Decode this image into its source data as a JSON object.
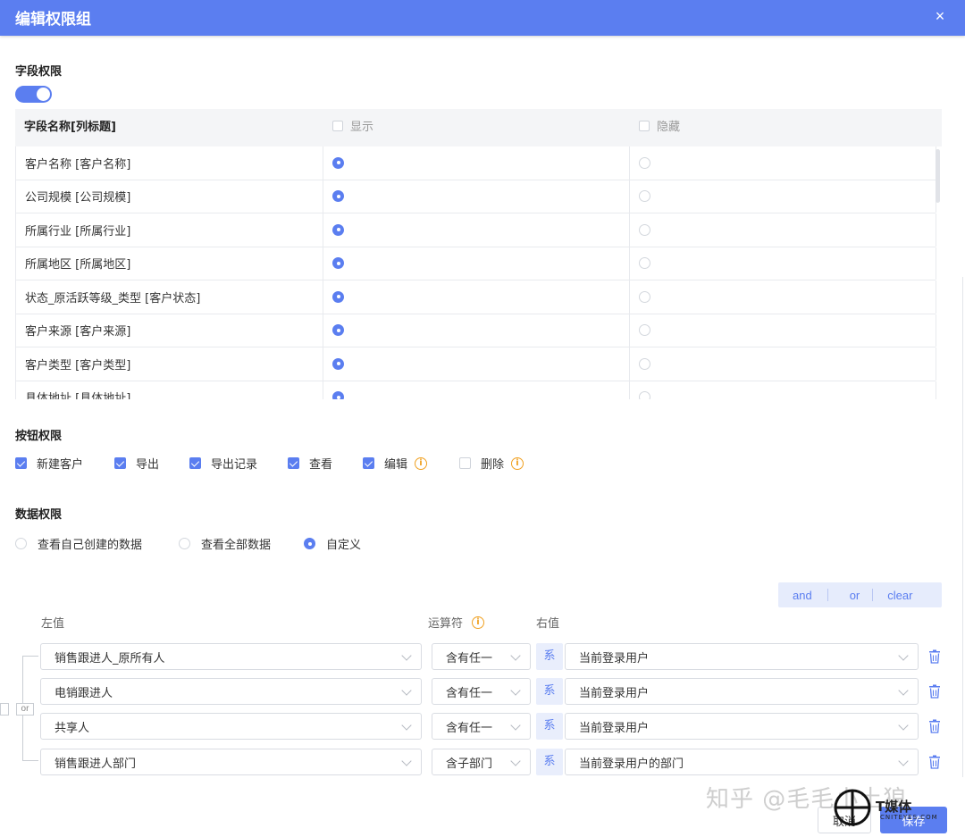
{
  "header": {
    "title": "编辑权限组",
    "close_icon": "×"
  },
  "field_permissions": {
    "title": "字段权限",
    "enabled": true,
    "columns": [
      "字段名称[列标题]",
      "显示",
      "隐藏"
    ],
    "rows": [
      {
        "name": "客户名称 [客户名称]",
        "value": "显示"
      },
      {
        "name": "公司规模 [公司规模]",
        "value": "显示"
      },
      {
        "name": "所属行业 [所属行业]",
        "value": "显示"
      },
      {
        "name": "所属地区 [所属地区]",
        "value": "显示"
      },
      {
        "name": "状态_原活跃等级_类型 [客户状态]",
        "value": "显示"
      },
      {
        "name": "客户来源 [客户来源]",
        "value": "显示"
      },
      {
        "name": "客户类型 [客户类型]",
        "value": "显示"
      },
      {
        "name": "具体地址 [具体地址]",
        "value": "显示"
      }
    ]
  },
  "button_permissions": {
    "title": "按钮权限",
    "items": [
      {
        "label": "新建客户",
        "checked": true,
        "info": false
      },
      {
        "label": "导出",
        "checked": true,
        "info": false
      },
      {
        "label": "导出记录",
        "checked": true,
        "info": false
      },
      {
        "label": "查看",
        "checked": true,
        "info": false
      },
      {
        "label": "编辑",
        "checked": true,
        "info": true
      },
      {
        "label": "删除",
        "checked": false,
        "info": true
      }
    ]
  },
  "data_permissions": {
    "title": "数据权限",
    "options": [
      "查看自己创建的数据",
      "查看全部数据",
      "自定义"
    ],
    "selected": "自定义"
  },
  "logic_buttons": {
    "and": "and",
    "or": "or",
    "clear": "clear"
  },
  "conditions_header": {
    "left": "左值",
    "operator": "运算符",
    "right": "右值"
  },
  "or_badge": "or",
  "conditions": [
    {
      "left": "销售跟进人_原所有人",
      "operator": "含有任一",
      "sys": "系",
      "right": "当前登录用户"
    },
    {
      "left": "电销跟进人",
      "operator": "含有任一",
      "sys": "系",
      "right": "当前登录用户"
    },
    {
      "left": "共享人",
      "operator": "含有任一",
      "sys": "系",
      "right": "当前登录用户"
    },
    {
      "left": "销售跟进人部门",
      "operator": "含子部门",
      "sys": "系",
      "right": "当前登录用户的部门"
    }
  ],
  "footer": {
    "cancel": "取消",
    "confirm": "保存"
  },
  "watermark": {
    "zhihu": "知乎 @毛毛小土狼",
    "brand": "T媒体",
    "brand_sub": "CNITEYES.COM"
  },
  "colors": {
    "primary": "#5b7ef0",
    "warning": "#f0a020"
  }
}
